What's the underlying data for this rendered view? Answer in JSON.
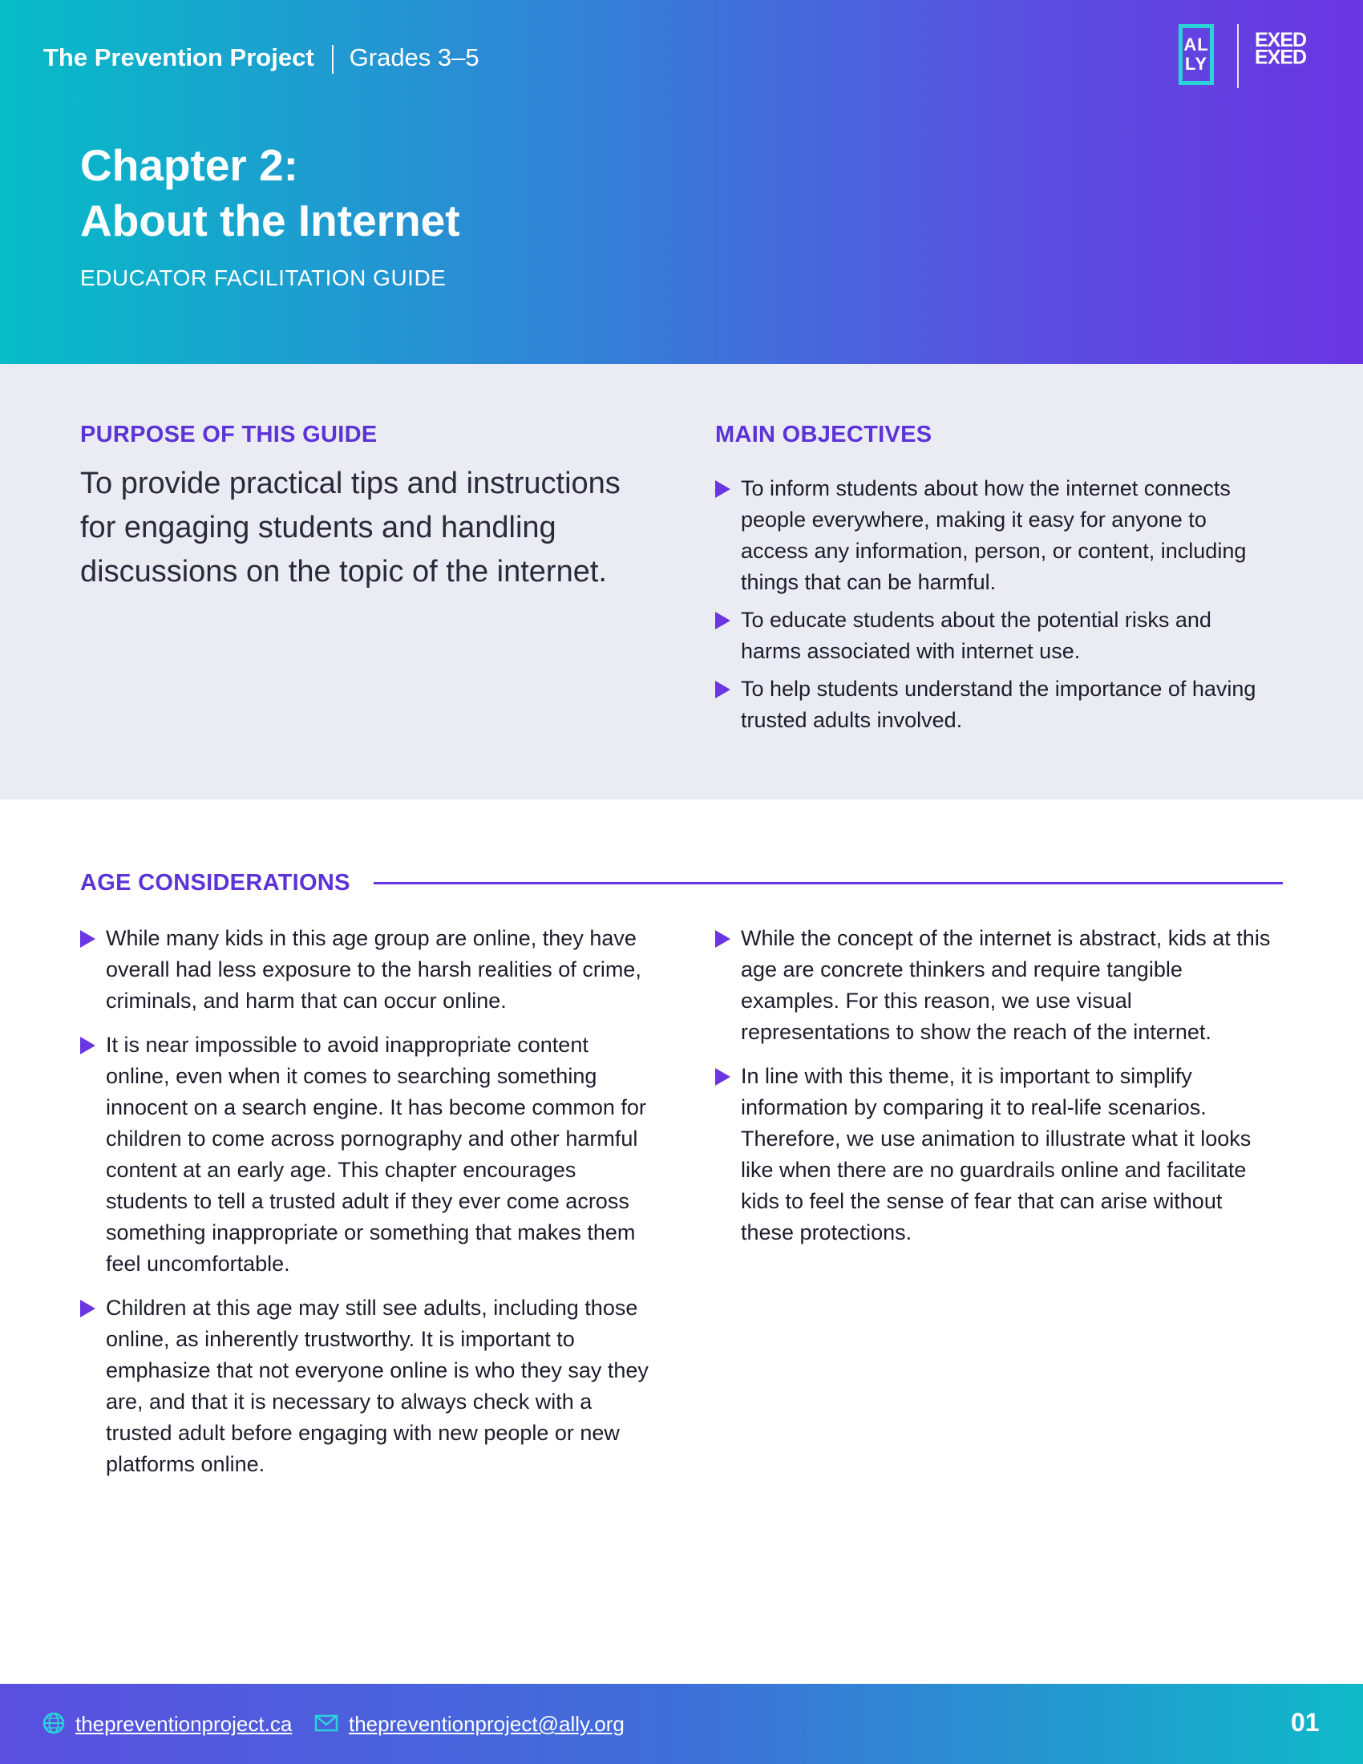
{
  "header": {
    "brand": "The Prevention Project",
    "grade": "Grades 3–5",
    "chapter_line1": "Chapter 2:",
    "chapter_line2": "About the Internet",
    "subtitle": "EDUCATOR FACILITATION GUIDE",
    "logo_ally_line1": "AL",
    "logo_ally_line2": "LY",
    "logo_exed": "EXED"
  },
  "purpose": {
    "heading": "PURPOSE OF THIS GUIDE",
    "text": "To provide practical tips and instructions for engaging students and handling discussions on the topic of the internet."
  },
  "objectives": {
    "heading": "MAIN OBJECTIVES",
    "items": [
      "To inform students about how the internet connects people everywhere, making it easy for anyone to access any information, person, or content, including things that can be harmful.",
      "To educate students about the potential risks and harms associated with internet use.",
      "To help students understand the importance of having trusted adults involved."
    ]
  },
  "age": {
    "heading": "AGE CONSIDERATIONS",
    "left_items": [
      "While many kids in this age group are online, they have overall had less exposure to the harsh realities of crime, criminals, and harm that can occur online.",
      "It is near impossible to avoid inappropriate content online, even when it comes to searching something innocent on a search engine. It has become common for children to come across pornography and other harmful content at an early age. This chapter encourages students to tell a trusted adult if they ever come across something inappropriate or something that makes them feel uncomfortable.",
      "Children at this age may still see adults, including those online, as inherently trustworthy. It is important to emphasize that not everyone online is who they say they are, and that it is necessary to always check with a trusted adult before engaging with new people or new platforms online."
    ],
    "right_items": [
      "While the concept of the internet is abstract, kids at this age are concrete thinkers and require tangible examples. For this reason, we use visual representations to show the reach of the internet.",
      "In line with this theme, it is important to simplify information by comparing it to real-life scenarios. Therefore, we use animation to illustrate what it looks like when there are no guardrails online and facilitate kids to feel the sense of fear that can arise without these protections."
    ]
  },
  "footer": {
    "website": "thepreventionproject.ca",
    "email": "thepreventionproject@ally.org",
    "page": "01"
  },
  "icons": {
    "globe": "globe-icon",
    "mail": "mail-icon",
    "bullet": "triangle-bullet-icon"
  },
  "colors": {
    "accent": "#6a35e2",
    "heading": "#5b33d6",
    "band": "#ebebf3",
    "teal": "#06bcc7"
  }
}
